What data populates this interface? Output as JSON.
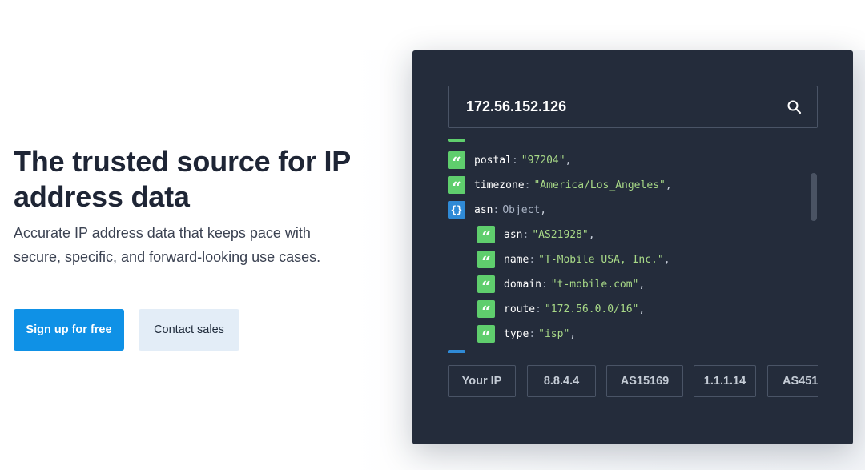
{
  "hero": {
    "title": "The trusted source for IP address data",
    "subtitle": "Accurate IP address data that keeps pace with secure, specific, and forward-looking use cases.",
    "primary_button": "Sign up for free",
    "secondary_button": "Contact sales"
  },
  "lookup": {
    "query": "172.56.152.126",
    "search_icon": "search-icon"
  },
  "result": {
    "postal": {
      "key": "postal",
      "value": "\"97204\""
    },
    "timezone": {
      "key": "timezone",
      "value": "\"America/Los_Angeles\""
    },
    "asn": {
      "key": "asn",
      "type": "Object",
      "asn": {
        "key": "asn",
        "value": "\"AS21928\""
      },
      "name": {
        "key": "name",
        "value": "\"T-Mobile USA, Inc.\""
      },
      "domain": {
        "key": "domain",
        "value": "\"t-mobile.com\""
      },
      "route": {
        "key": "route",
        "value": "\"172.56.0.0/16\""
      },
      "type_field": {
        "key": "type",
        "value": "\"isp\""
      }
    }
  },
  "chips": [
    "Your IP",
    "8.8.4.4",
    "AS15169",
    "1.1.1.14",
    "AS451"
  ],
  "colors": {
    "accent": "#0f91e6",
    "panel": "#242c3b",
    "string_badge": "#5fce6d",
    "object_badge": "#2f8ad6",
    "string_value": "#a8d987"
  }
}
